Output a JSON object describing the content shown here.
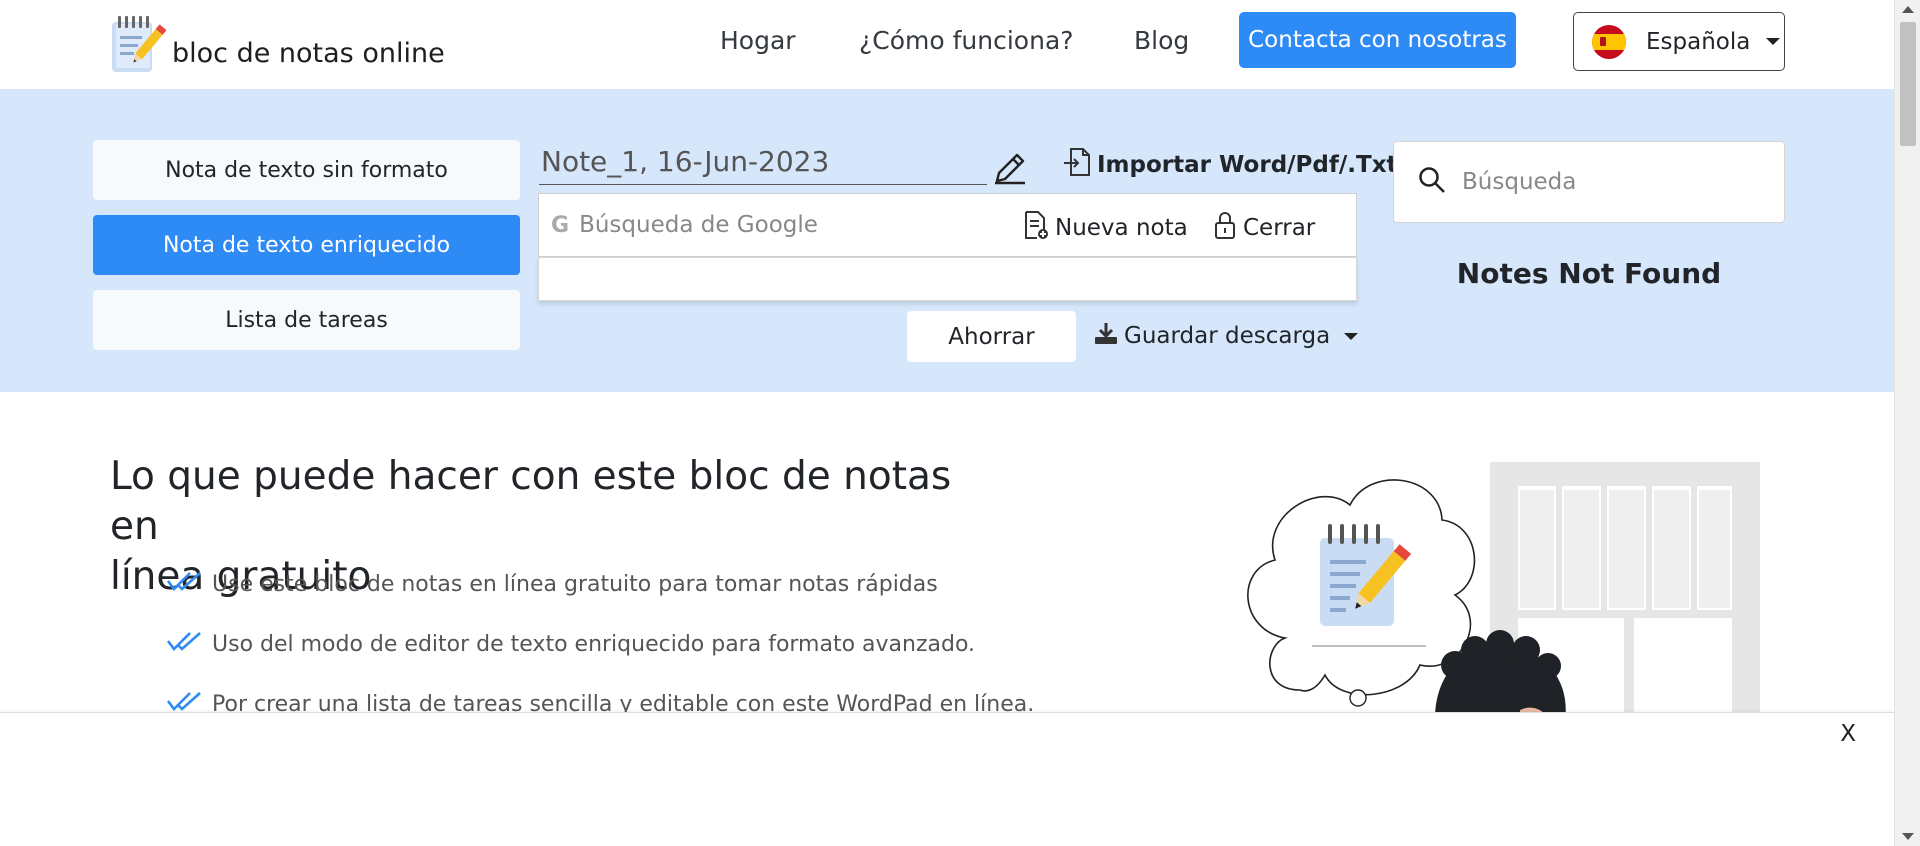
{
  "header": {
    "logo_text": "bloc de notas online",
    "nav": [
      "Hogar",
      "¿Cómo funciona?",
      "Blog"
    ],
    "contact_label": "Contacta con nosotras",
    "language_label": "Española"
  },
  "modes": {
    "plain": "Nota de texto sin formato",
    "rich": "Nota de texto enriquecido",
    "tasks": "Lista de tareas"
  },
  "editor": {
    "note_title": "Note_1, 16-Jun-2023",
    "import_label": "Importar Word/Pdf/.Txt",
    "google_placeholder": "Búsqueda de Google",
    "new_note_label": "Nueva nota",
    "close_label": "Cerrar",
    "save_label": "Ahorrar",
    "download_label": "Guardar descarga"
  },
  "sidebar": {
    "search_placeholder": "Búsqueda",
    "not_found": "Notes Not Found"
  },
  "content": {
    "headline_line1": "Lo que puede hacer con este bloc de notas en",
    "headline_line2": "línea gratuito",
    "features": [
      "Use este bloc de notas en línea gratuito para tomar notas rápidas",
      "Uso del modo de editor de texto enriquecido para formato avanzado.",
      "Por crear una lista de tareas sencilla y editable con este WordPad en línea."
    ]
  },
  "ad": {
    "close_label": "X"
  },
  "colors": {
    "accent": "#2e8bf6",
    "toolbar_bg": "#d6e6fb"
  },
  "icons": [
    "notepad-logo-icon",
    "spain-flag-icon",
    "pencil-icon",
    "import-file-icon",
    "google-icon",
    "new-note-icon",
    "lock-icon",
    "download-icon",
    "search-icon",
    "double-check-icon"
  ]
}
